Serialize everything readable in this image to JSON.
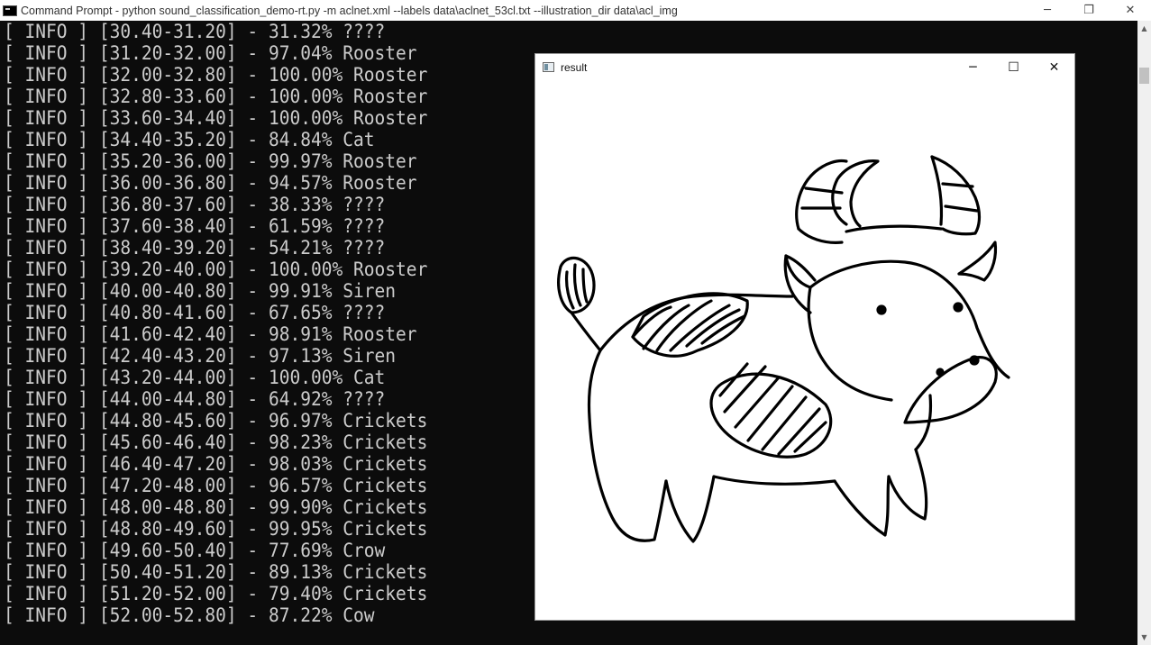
{
  "window": {
    "title": "Command Prompt - python  sound_classification_demo-rt.py -m aclnet.xml --labels data\\aclnet_53cl.txt --illustration_dir data\\acl_img",
    "controls": {
      "minimize": "─",
      "restore": "❐",
      "close": "✕"
    }
  },
  "console": {
    "lines": [
      "[ INFO ] [30.40-31.20] - 31.32% ????",
      "[ INFO ] [31.20-32.00] - 97.04% Rooster",
      "[ INFO ] [32.00-32.80] - 100.00% Rooster",
      "[ INFO ] [32.80-33.60] - 100.00% Rooster",
      "[ INFO ] [33.60-34.40] - 100.00% Rooster",
      "[ INFO ] [34.40-35.20] - 84.84% Cat",
      "[ INFO ] [35.20-36.00] - 99.97% Rooster",
      "[ INFO ] [36.00-36.80] - 94.57% Rooster",
      "[ INFO ] [36.80-37.60] - 38.33% ????",
      "[ INFO ] [37.60-38.40] - 61.59% ????",
      "[ INFO ] [38.40-39.20] - 54.21% ????",
      "[ INFO ] [39.20-40.00] - 100.00% Rooster",
      "[ INFO ] [40.00-40.80] - 99.91% Siren",
      "[ INFO ] [40.80-41.60] - 67.65% ????",
      "[ INFO ] [41.60-42.40] - 98.91% Rooster",
      "[ INFO ] [42.40-43.20] - 97.13% Siren",
      "[ INFO ] [43.20-44.00] - 100.00% Cat",
      "[ INFO ] [44.00-44.80] - 64.92% ????",
      "[ INFO ] [44.80-45.60] - 96.97% Crickets",
      "[ INFO ] [45.60-46.40] - 98.23% Crickets",
      "[ INFO ] [46.40-47.20] - 98.03% Crickets",
      "[ INFO ] [47.20-48.00] - 96.57% Crickets",
      "[ INFO ] [48.00-48.80] - 99.90% Crickets",
      "[ INFO ] [48.80-49.60] - 99.95% Crickets",
      "[ INFO ] [49.60-50.40] - 77.69% Crow",
      "[ INFO ] [50.40-51.20] - 89.13% Crickets",
      "[ INFO ] [51.20-52.00] - 79.40% Crickets",
      "[ INFO ] [52.00-52.80] - 87.22% Cow"
    ]
  },
  "result_window": {
    "title": "result",
    "controls": {
      "minimize": "─",
      "maximize": "☐",
      "close": "✕"
    },
    "illustration": "cow-drawing"
  },
  "colors": {
    "console_bg": "#0c0c0c",
    "console_text": "#cccccc",
    "window_bg": "#ffffff"
  }
}
